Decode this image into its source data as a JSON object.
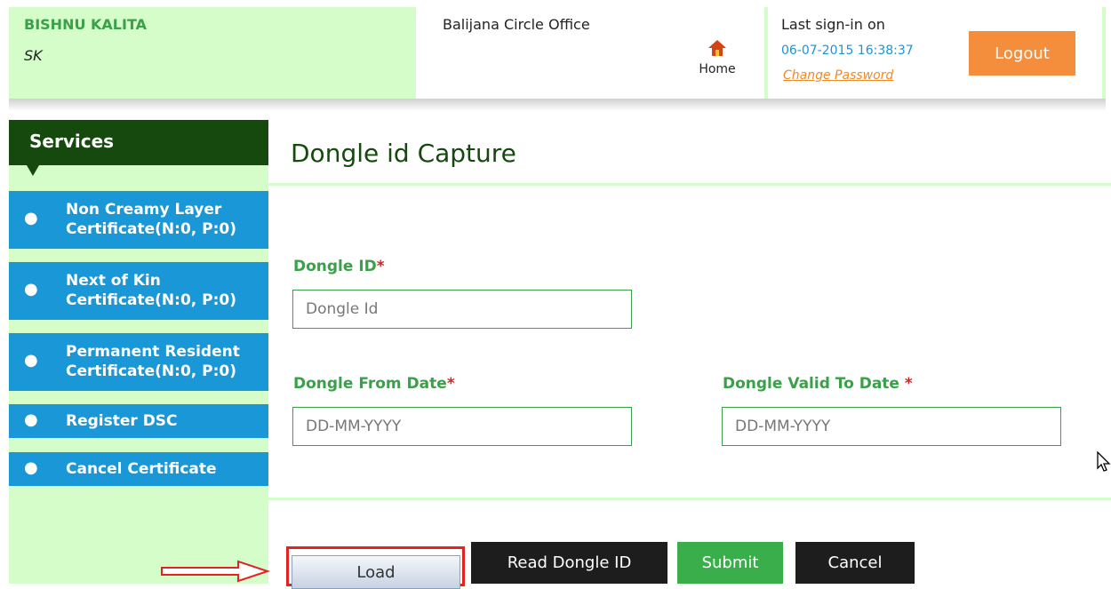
{
  "header": {
    "user_name": "BISHNU KALITA",
    "user_code": "SK",
    "office": "Balijana Circle Office",
    "home_label": "Home",
    "last_signin_label": "Last sign-in on",
    "last_signin_date": "06-07-2015 16:38:37",
    "change_password": "Change Password",
    "logout_label": "Logout"
  },
  "sidebar": {
    "title": "Services",
    "items": [
      {
        "line1": "Non Creamy Layer",
        "line2": "Certificate(N:0, P:0)"
      },
      {
        "line1": "Next of Kin",
        "line2": "Certificate(N:0, P:0)"
      },
      {
        "line1": "Permanent Resident",
        "line2": "Certificate(N:0, P:0)"
      },
      {
        "line1": "Register DSC",
        "line2": ""
      },
      {
        "line1": "Cancel Certificate",
        "line2": ""
      }
    ]
  },
  "main": {
    "title": "Dongle id Capture",
    "dongle_id_label": "Dongle ID",
    "dongle_id_placeholder": "Dongle Id",
    "from_date_label": "Dongle From Date",
    "from_date_placeholder": "DD-MM-YYYY",
    "valid_to_label": "Dongle Valid To Date ",
    "valid_to_placeholder": "DD-MM-YYYY",
    "required_mark": "*"
  },
  "actions": {
    "load": "Load",
    "read_dongle": "Read Dongle ID",
    "submit": "Submit",
    "cancel": "Cancel"
  },
  "colors": {
    "light_green": "#d4fdca",
    "dark_green": "#15490e",
    "label_green": "#3aa04a",
    "menu_blue": "#1a97d6",
    "logout_orange": "#f58e3c",
    "submit_green": "#3aae4a",
    "dark_button": "#1d1d1d"
  },
  "icons": {
    "home": "home-icon",
    "arrow": "red-arrow-icon",
    "cursor": "mouse-cursor-icon"
  }
}
